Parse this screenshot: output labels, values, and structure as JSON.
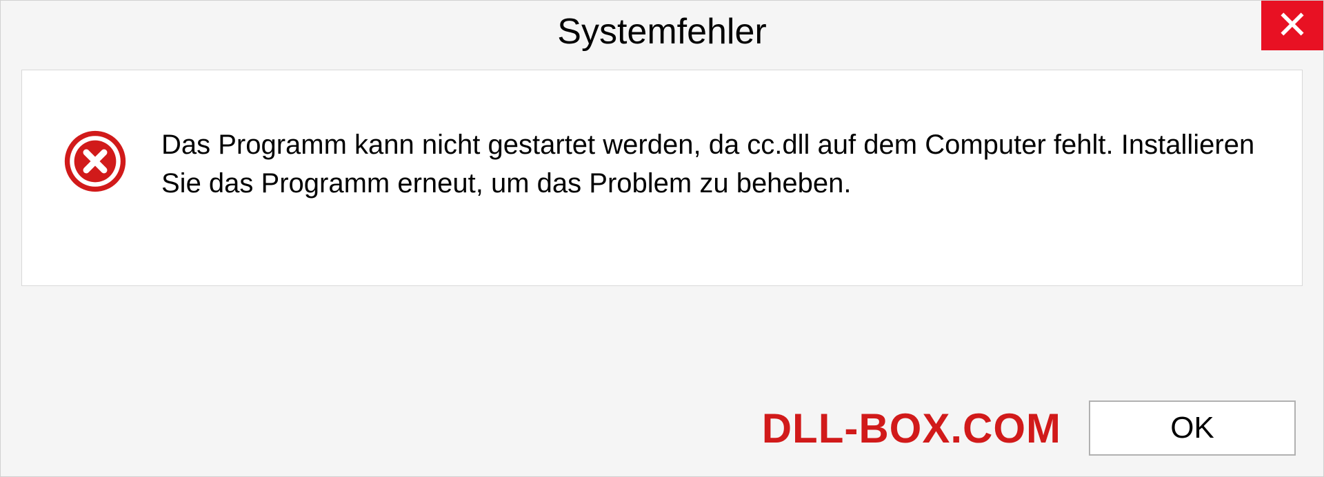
{
  "dialog": {
    "title": "Systemfehler",
    "message": "Das Programm kann nicht gestartet werden, da cc.dll auf dem Computer fehlt. Installieren Sie das Programm erneut, um das Problem zu beheben.",
    "ok_label": "OK"
  },
  "watermark": "DLL-BOX.COM",
  "colors": {
    "close_button": "#e81123",
    "error_icon": "#d11a1a",
    "watermark": "#d11a1a"
  }
}
